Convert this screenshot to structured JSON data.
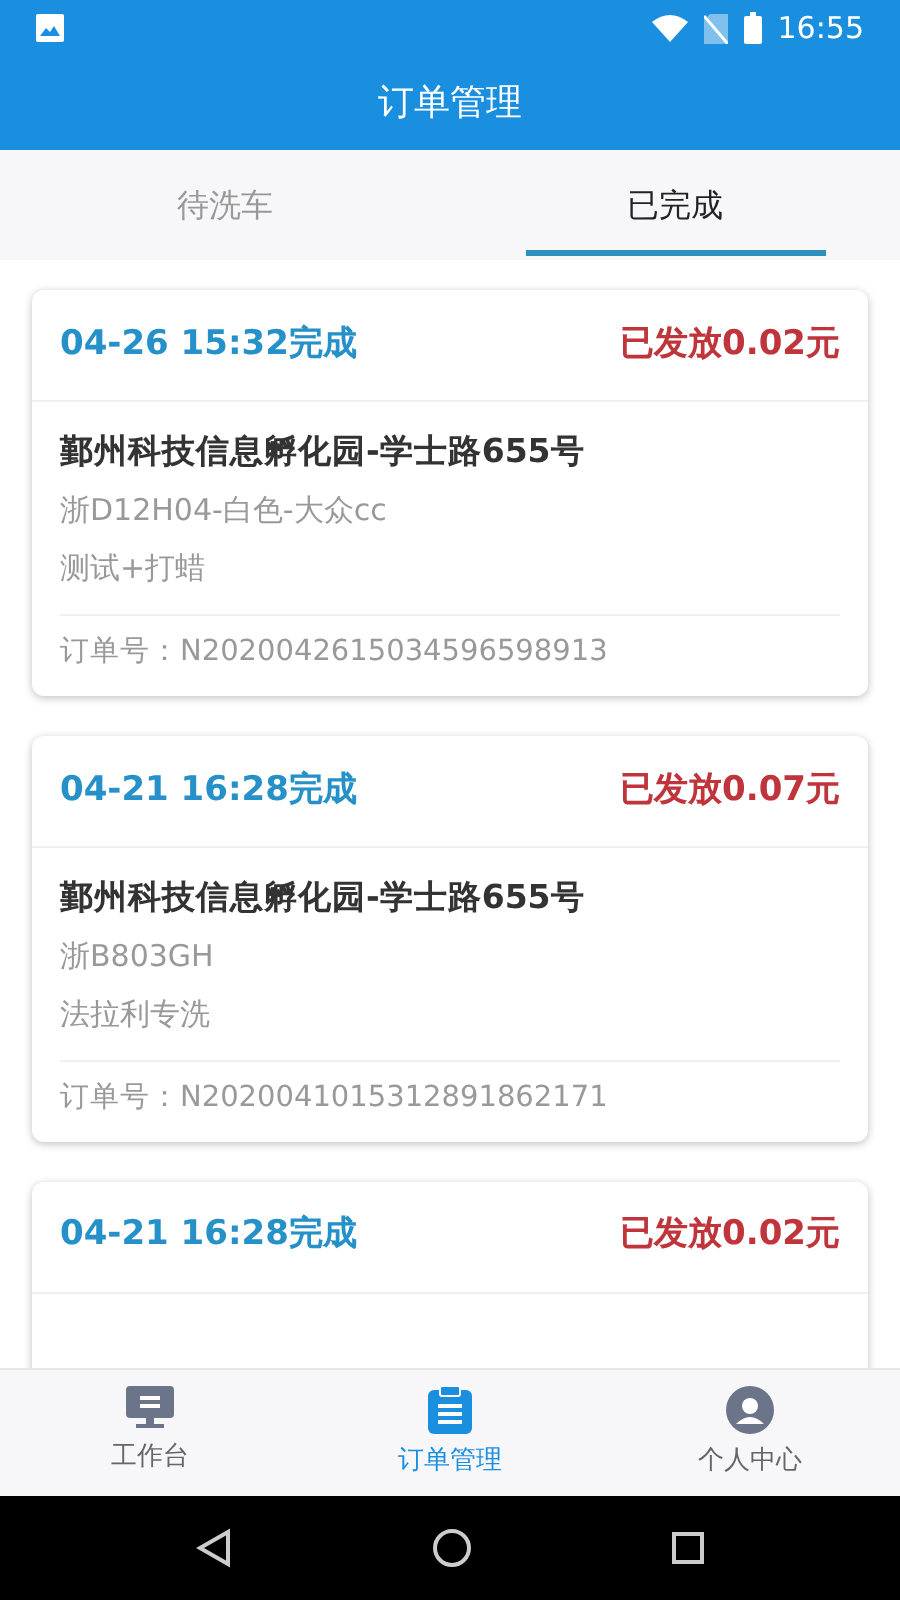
{
  "status_bar": {
    "time": "16:55"
  },
  "header": {
    "title": "订单管理"
  },
  "tabs": [
    {
      "label": "待洗车",
      "selected": false
    },
    {
      "label": "已完成",
      "selected": true
    }
  ],
  "orders": [
    {
      "finished": "04-26 15:32完成",
      "payout": "已发放0.02元",
      "address": "鄞州科技信息孵化园-学士路655号",
      "vehicle": "浙D12H04-白色-大众cc",
      "service": "测试+打蜡",
      "order_no": "订单号：N2020042615034596598913"
    },
    {
      "finished": "04-21 16:28完成",
      "payout": "已发放0.07元",
      "address": "鄞州科技信息孵化园-学士路655号",
      "vehicle": "浙B803GH",
      "service": "法拉利专洗",
      "order_no": "订单号：N2020041015312891862171"
    },
    {
      "finished": "04-21 16:28完成",
      "payout": "已发放0.02元"
    }
  ],
  "bottom_nav": [
    {
      "label": "工作台",
      "kind": "desk",
      "selected": false
    },
    {
      "label": "订单管理",
      "kind": "clipboard",
      "selected": true
    },
    {
      "label": "个人中心",
      "kind": "person",
      "selected": false
    }
  ]
}
